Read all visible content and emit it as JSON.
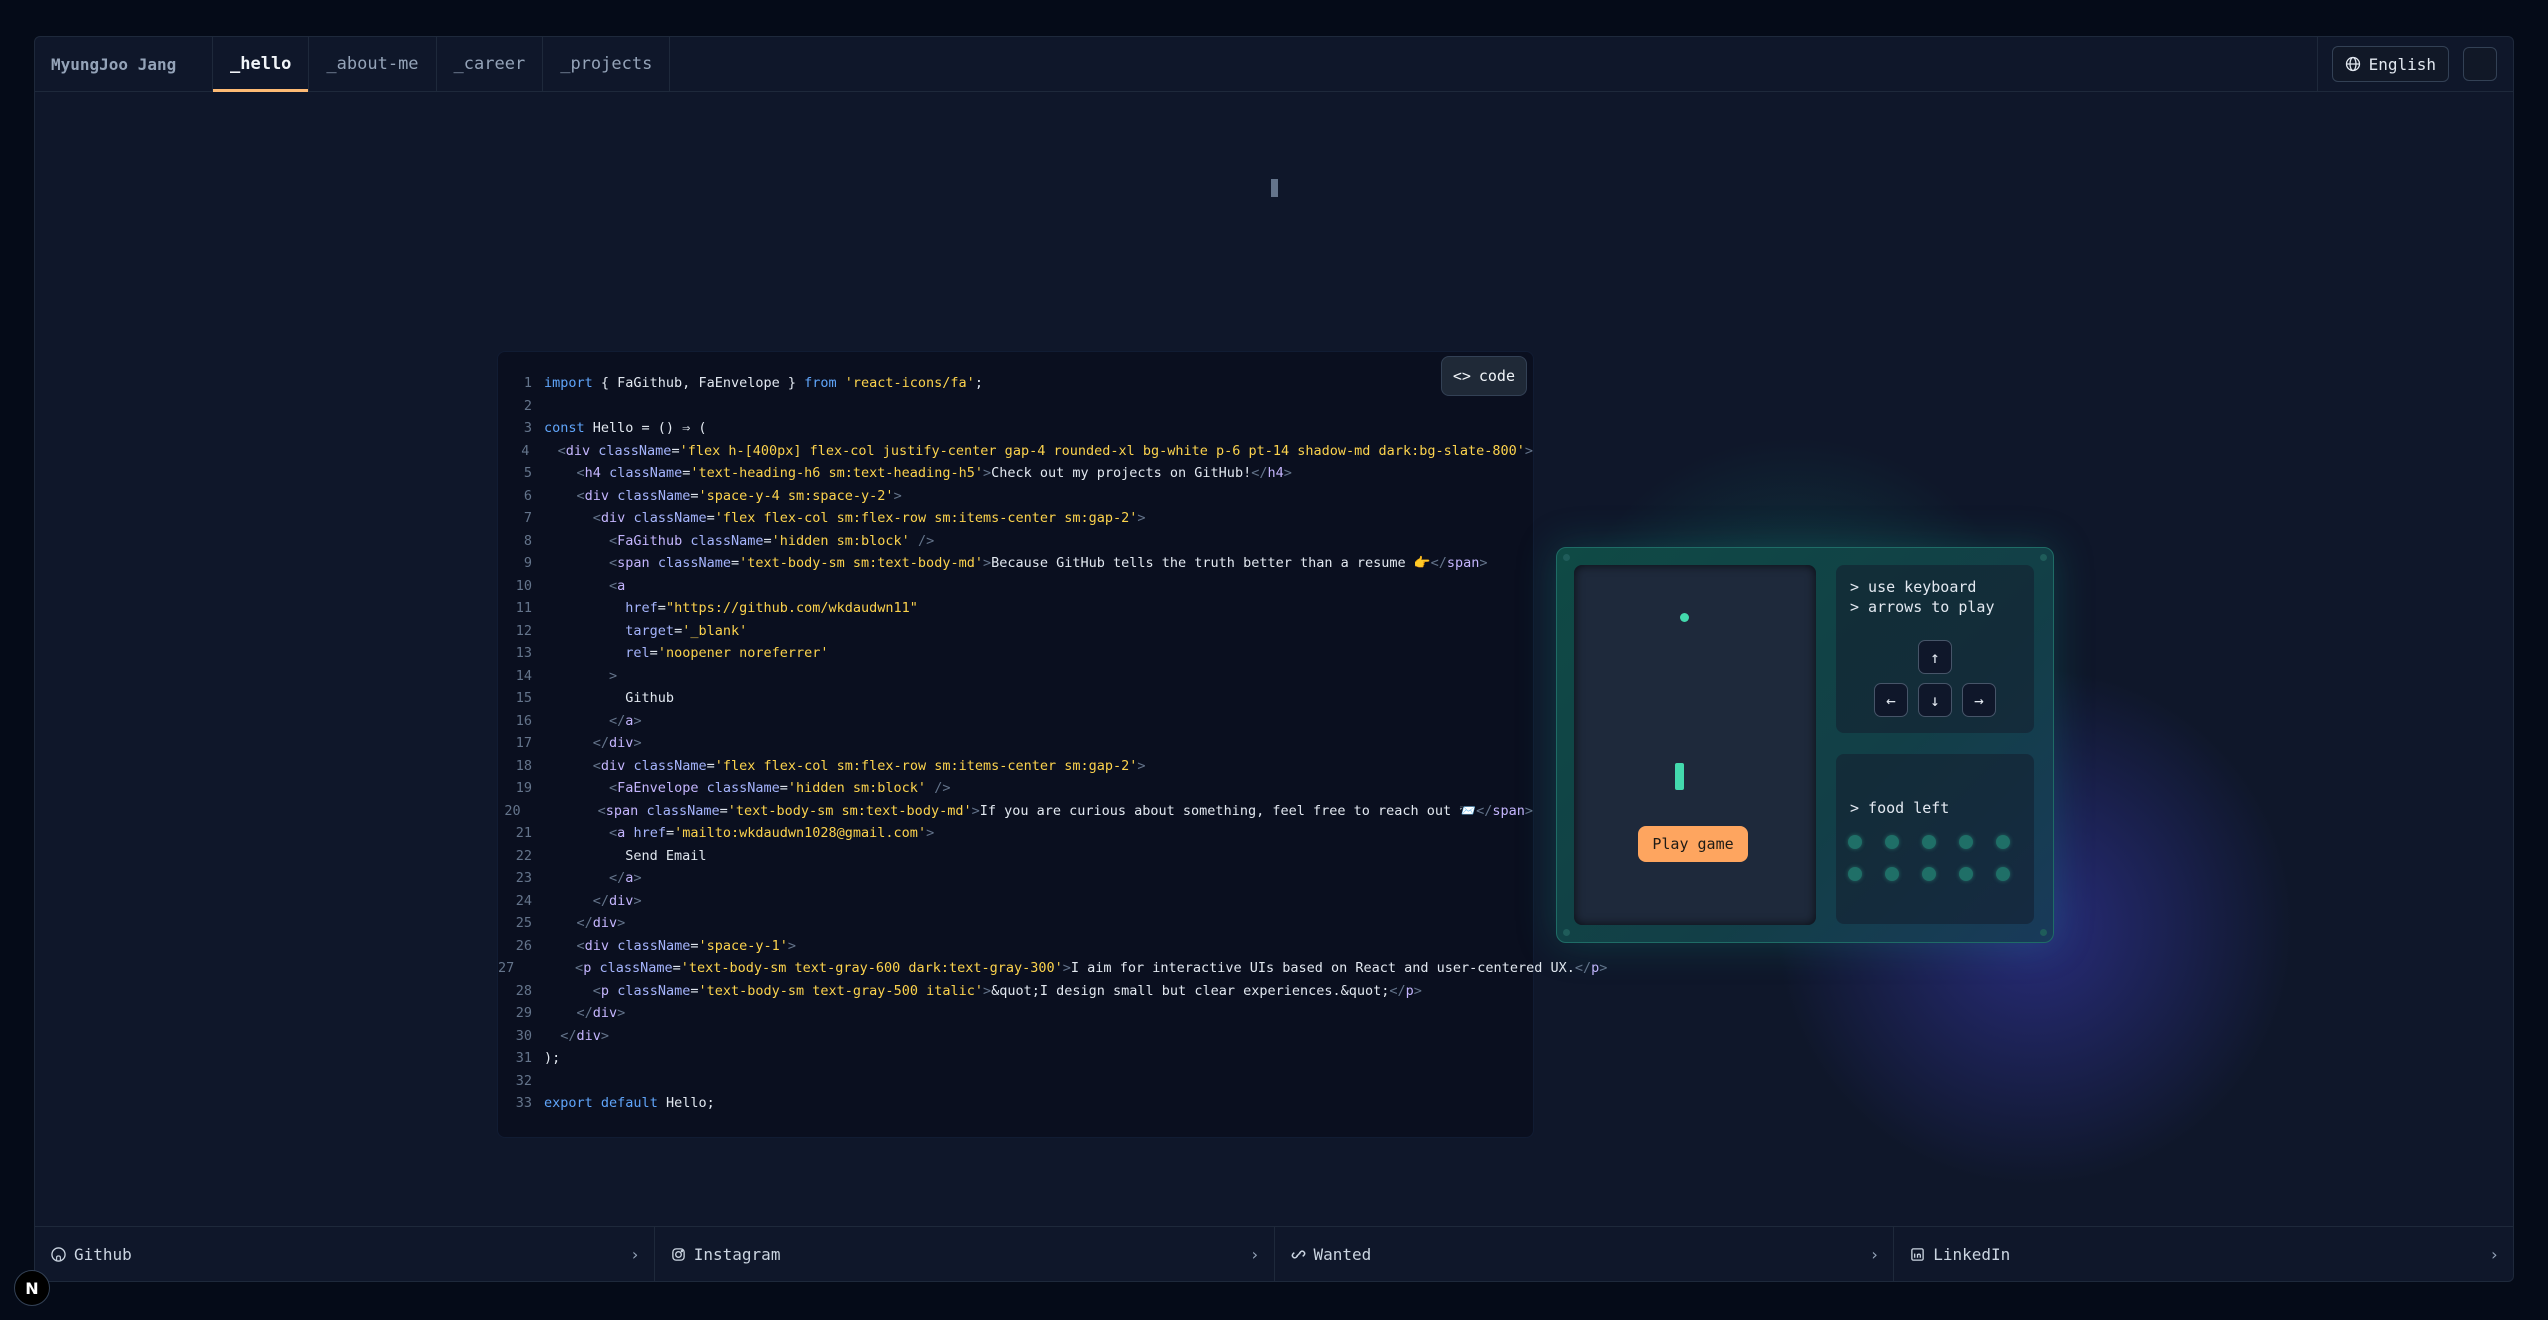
{
  "header": {
    "brand": "MyungJoo Jang",
    "tabs": [
      {
        "label": "_hello",
        "active": true
      },
      {
        "label": "_about-me",
        "active": false
      },
      {
        "label": "_career",
        "active": false
      },
      {
        "label": "_projects",
        "active": false
      }
    ],
    "language_label": "English"
  },
  "code_panel": {
    "button_label": "code",
    "lines": [
      "import { FaGithub, FaEnvelope } from 'react-icons/fa';",
      "",
      "const Hello = () ⇒ (",
      "  <div className='flex h-[400px] flex-col justify-center gap-4 rounded-xl bg-white p-6 pt-14 shadow-md dark:bg-slate-800'>",
      "    <h4 className='text-heading-h6 sm:text-heading-h5'>Check out my projects on GitHub!</h4>",
      "    <div className='space-y-4 sm:space-y-2'>",
      "      <div className='flex flex-col sm:flex-row sm:items-center sm:gap-2'>",
      "        <FaGithub className='hidden sm:block' />",
      "        <span className='text-body-sm sm:text-body-md'>Because GitHub tells the truth better than a resume 👉</span>",
      "        <a",
      "          href=\"https://github.com/wkdaudwn11\"",
      "          target='_blank'",
      "          rel='noopener noreferrer'",
      "        >",
      "          Github",
      "        </a>",
      "      </div>",
      "      <div className='flex flex-col sm:flex-row sm:items-center sm:gap-2'>",
      "        <FaEnvelope className='hidden sm:block' />",
      "        <span className='text-body-sm sm:text-body-md'>If you are curious about something, feel free to reach out 📨</span>",
      "        <a href='mailto:wkdaudwn1028@gmail.com'>",
      "          Send Email",
      "        </a>",
      "      </div>",
      "    </div>",
      "    <div className='space-y-1'>",
      "      <p className='text-body-sm text-gray-600 dark:text-gray-300'>I aim for interactive UIs based on React and user-centered UX.</p>",
      "      <p className='text-body-sm text-gray-500 italic'>&quot;I design small but clear experiences.&quot;</p>",
      "    </div>",
      "  </div>",
      ");",
      "",
      "export default Hello;"
    ]
  },
  "game": {
    "hint_line1": "> use keyboard",
    "hint_line2": "> arrows to play",
    "play_button": "Play game",
    "food_label": "> food left",
    "food_count": 10,
    "keys": [
      "arrow-up",
      "arrow-left",
      "arrow-down",
      "arrow-right"
    ]
  },
  "footer": {
    "links": [
      {
        "label": "Github",
        "icon": "github-icon"
      },
      {
        "label": "Instagram",
        "icon": "instagram-icon"
      },
      {
        "label": "Wanted",
        "icon": "link-icon"
      },
      {
        "label": "LinkedIn",
        "icon": "linkedin-icon"
      }
    ]
  },
  "badge": "N",
  "colors": {
    "accent_orange": "#fea55f",
    "snake_green": "#43d9ad",
    "background": "#0f172a"
  }
}
